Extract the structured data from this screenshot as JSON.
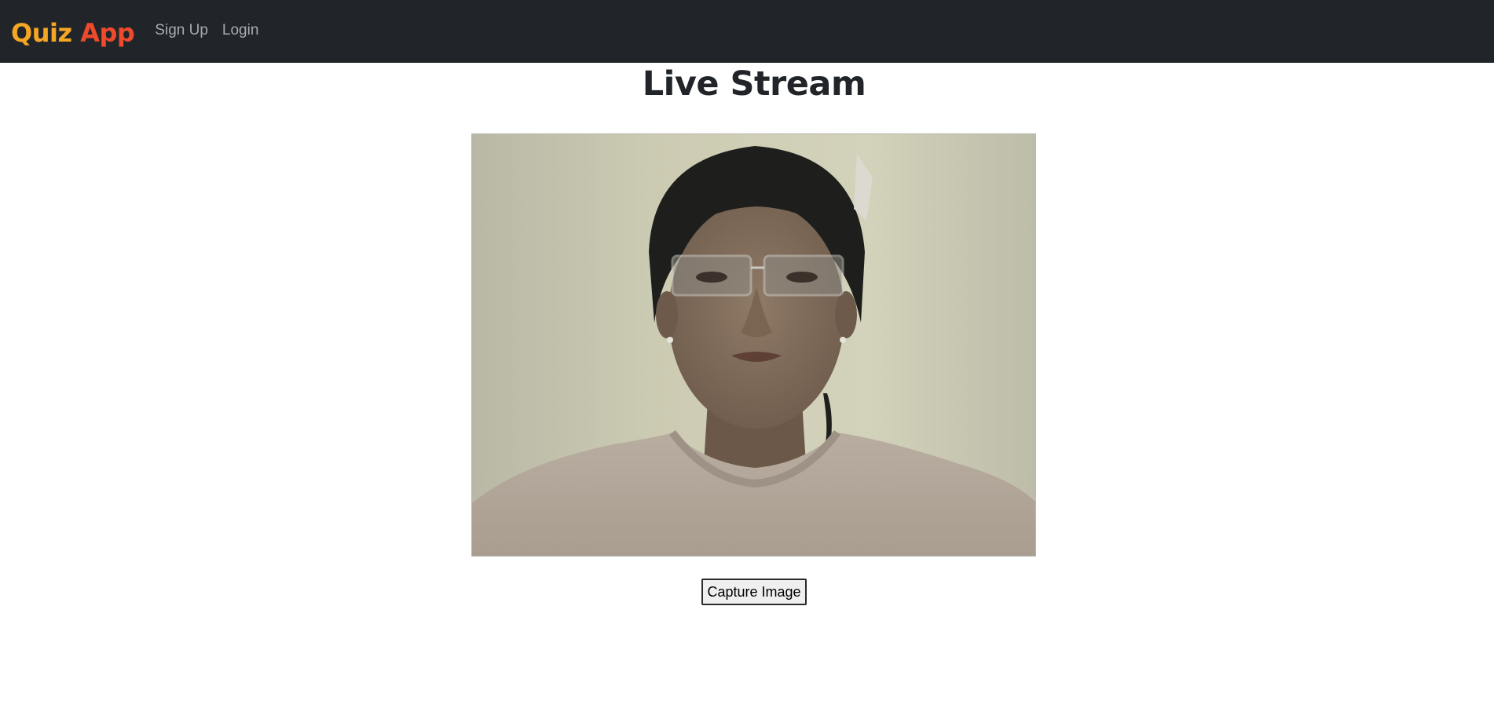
{
  "navbar": {
    "brand_part1": "Quiz",
    "brand_part2": "App",
    "links": [
      {
        "label": "Sign Up"
      },
      {
        "label": "Login"
      }
    ],
    "colors": {
      "background": "#212529",
      "brand_orange": "#f5a623",
      "brand_red": "#ee4a2b",
      "link": "#a8abaf"
    }
  },
  "main": {
    "title": "Live Stream",
    "video": {
      "icon": "webcam-feed"
    },
    "capture_button_label": "Capture Image"
  }
}
